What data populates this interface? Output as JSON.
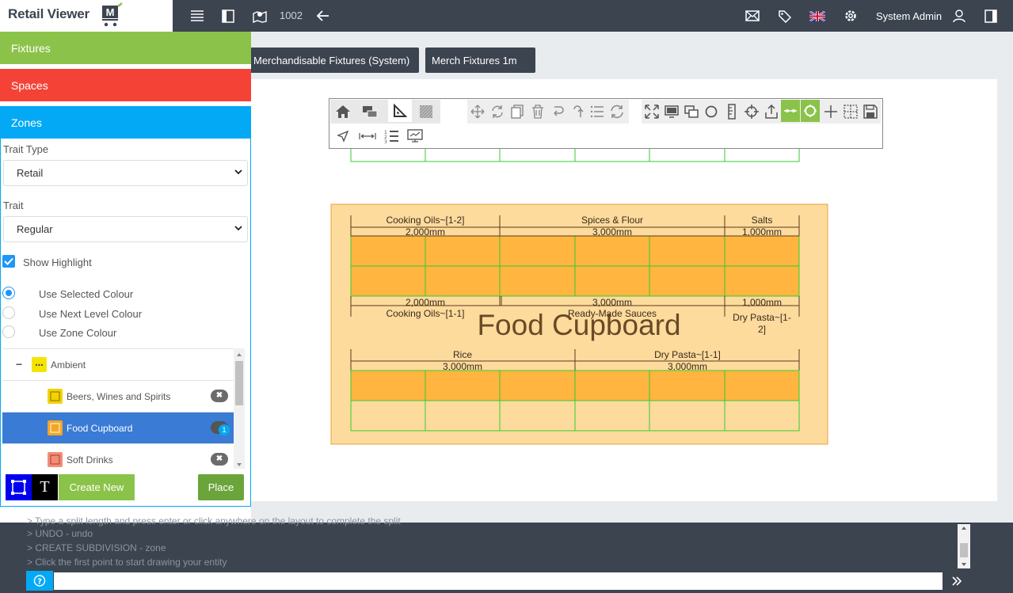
{
  "app": {
    "logo_text": "Retail Viewer",
    "logo_badge": "M"
  },
  "topbar": {
    "planogram_id": "1002",
    "user_name": "System Admin"
  },
  "left_panel": {
    "sections": {
      "fixtures": "Fixtures",
      "spaces": "Spaces",
      "zones": "Zones"
    },
    "trait_type_label": "Trait Type",
    "trait_type_value": "Retail",
    "trait_label": "Trait",
    "trait_value": "Regular",
    "show_highlight_label": "Show Highlight",
    "show_highlight_checked": true,
    "colour_options": [
      {
        "label": "Use Selected Colour",
        "selected": true
      },
      {
        "label": "Use Next Level Colour",
        "selected": false
      },
      {
        "label": "Use Zone Colour",
        "selected": false
      }
    ],
    "tree": {
      "root": {
        "label": "Ambient",
        "collapse_glyph": "−",
        "swatch_color": "#f5e400"
      },
      "children": [
        {
          "label": "Beers, Wines and Spirits",
          "swatch_color": "#f2d300",
          "active": false,
          "remove_glyph": "✖"
        },
        {
          "label": "Food Cupboard",
          "swatch_color": "#f5a623",
          "active": true,
          "badge": "1"
        },
        {
          "label": "Soft Drinks",
          "swatch_color": "#f48c77",
          "active": false,
          "remove_glyph": "✖"
        }
      ]
    },
    "text_tool_glyph": "T",
    "create_new_label": "Create New",
    "place_label": "Place"
  },
  "tabs": [
    {
      "label": "Merchandisable Fixtures (System)"
    },
    {
      "label": "Merch Fixtures 1m"
    }
  ],
  "plan": {
    "zone_label": "Food Cupboard",
    "zone_fill": "#fddb9d",
    "zone_border": "#e8a23b",
    "shelf_fill": "#ffb53f",
    "fixture_line": "#33cc33",
    "top_row": [
      {
        "name": "Cooking Oils~[1-2]",
        "width": "2,000mm"
      },
      {
        "name": "Spices & Flour",
        "width": "3,000mm"
      },
      {
        "name": "Salts",
        "width": "1,000mm"
      }
    ],
    "middle_row_widths": [
      "2,000mm",
      "3,000mm",
      "1,000mm"
    ],
    "middle_row_names": [
      "Cooking Oils~[1-1]",
      "Ready-Made Sauces",
      "Dry Pasta~[1-",
      "2]"
    ],
    "bottom_row": [
      {
        "name": "Rice",
        "width": "3,000mm"
      },
      {
        "name": "Dry Pasta~[1-1]",
        "width": "3,000mm"
      }
    ]
  },
  "console": {
    "lines": [
      "> Type a split length and press enter or click anywhere on the layout to complete the split",
      "> UNDO - undo",
      "> CREATE SUBDIVISION - zone",
      "> Click the first point to start drawing your entity"
    ],
    "input_value": ""
  }
}
